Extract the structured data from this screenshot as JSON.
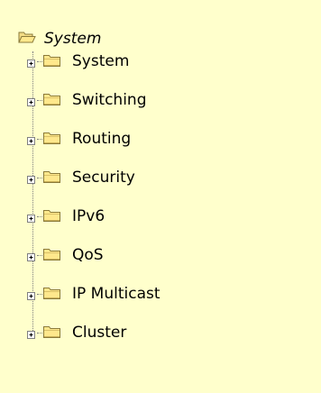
{
  "root": {
    "label": "System",
    "icon": "folder-open-icon"
  },
  "items": [
    {
      "label": "System",
      "expander": "plus-icon",
      "icon": "folder-icon"
    },
    {
      "label": "Switching",
      "expander": "plus-icon",
      "icon": "folder-icon"
    },
    {
      "label": "Routing",
      "expander": "plus-icon",
      "icon": "folder-icon"
    },
    {
      "label": "Security",
      "expander": "plus-icon",
      "icon": "folder-icon"
    },
    {
      "label": "IPv6",
      "expander": "plus-icon",
      "icon": "folder-icon"
    },
    {
      "label": "QoS",
      "expander": "plus-icon",
      "icon": "folder-icon"
    },
    {
      "label": "IP Multicast",
      "expander": "plus-icon",
      "icon": "folder-icon"
    },
    {
      "label": "Cluster",
      "expander": "plus-icon",
      "icon": "folder-icon"
    }
  ],
  "colors": {
    "background": "#ffffcc",
    "folder_fill": "#ffe88c",
    "folder_outline": "#8a7a3a",
    "tree_lines": "#808080"
  }
}
